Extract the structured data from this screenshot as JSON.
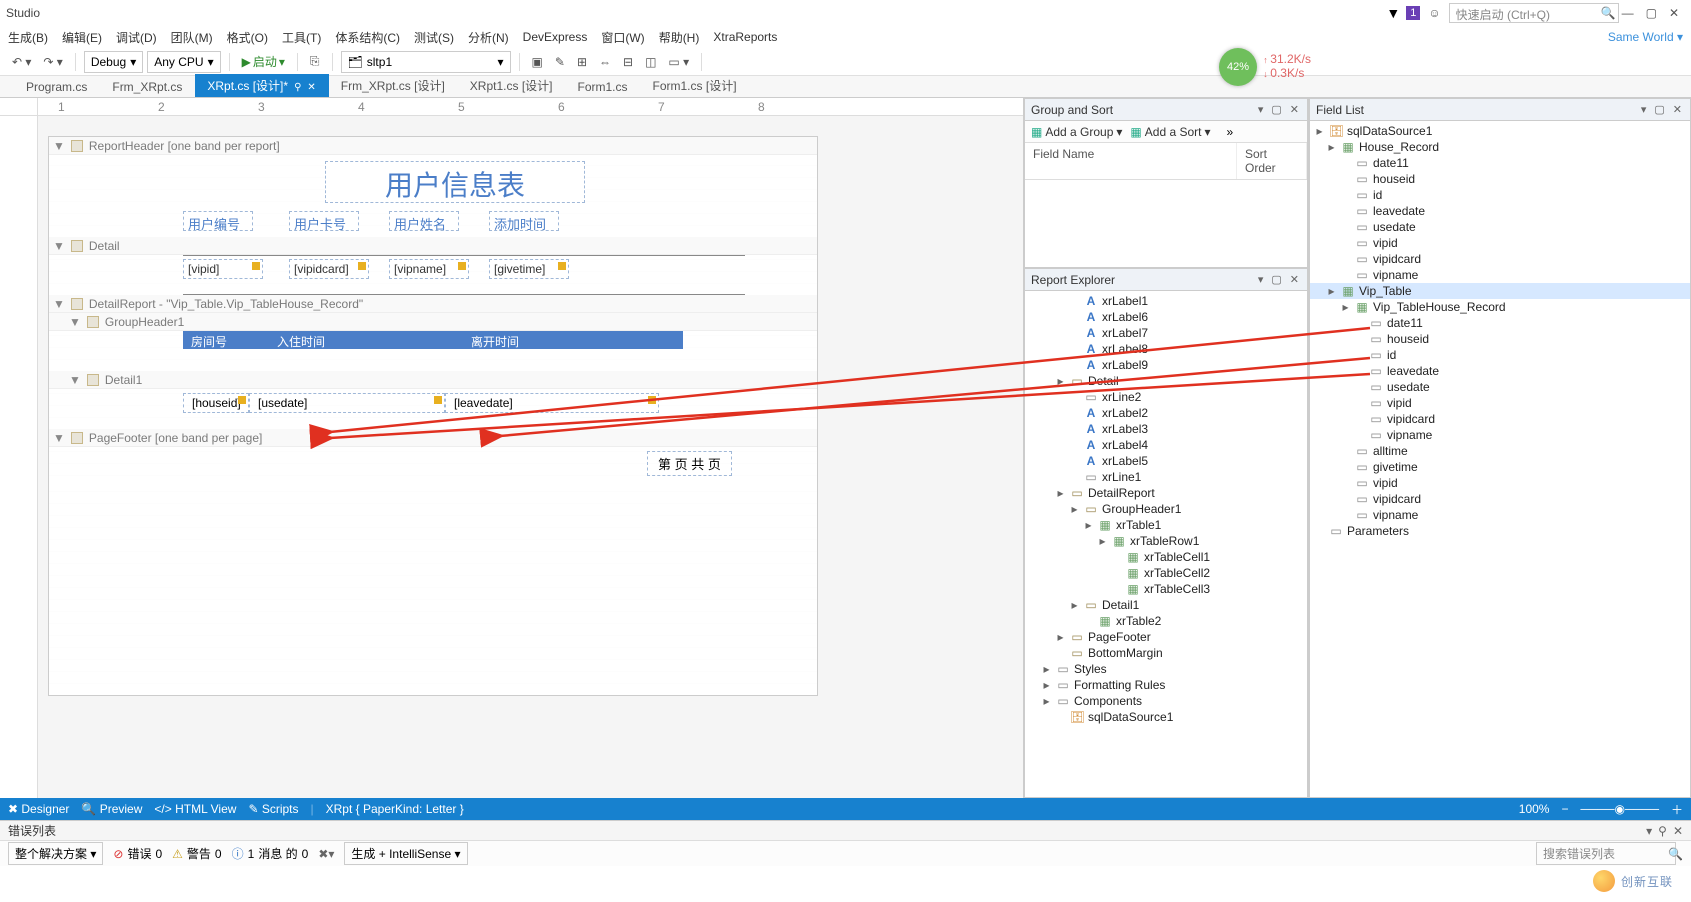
{
  "title_bar": {
    "title": "Studio",
    "quick_launch_placeholder": "快速启动 (Ctrl+Q)",
    "badge": "1"
  },
  "menu": {
    "items": [
      "生成(B)",
      "编辑(E)",
      "调试(D)",
      "团队(M)",
      "格式(O)",
      "工具(T)",
      "体系结构(C)",
      "测试(S)",
      "分析(N)",
      "DevExpress",
      "窗口(W)",
      "帮助(H)",
      "XtraReports"
    ],
    "right_label": "Same World"
  },
  "toolbar": {
    "debug": "Debug",
    "anycpu": "Any CPU",
    "start": "启动",
    "sltp": "sltp1"
  },
  "perf": {
    "pct": "42%",
    "up": "31.2K/s",
    "down": "0.3K/s"
  },
  "tabs": [
    {
      "label": "Program.cs"
    },
    {
      "label": "Frm_XRpt.cs"
    },
    {
      "label": "XRpt.cs [设计]*",
      "active": true
    },
    {
      "label": "Frm_XRpt.cs [设计]"
    },
    {
      "label": "XRpt1.cs [设计]"
    },
    {
      "label": "Form1.cs"
    },
    {
      "label": "Form1.cs [设计]"
    }
  ],
  "report": {
    "report_header_label": "ReportHeader [one band per report]",
    "title": "用户信息表",
    "col_labels": [
      "用户编号",
      "用户卡号",
      "用户姓名",
      "添加时间"
    ],
    "detail_label": "Detail",
    "fields": [
      "[vipid]",
      "[vipidcard]",
      "[vipname]",
      "[givetime]"
    ],
    "detail_report_label": "DetailReport - \"Vip_Table.Vip_TableHouse_Record\"",
    "group_header_label": "GroupHeader1",
    "gh_cols": [
      "房间号",
      "入住时间",
      "离开时间"
    ],
    "detail1_label": "Detail1",
    "d1_fields": [
      "[houseid]",
      "[usedate]",
      "[leavedate]"
    ],
    "page_footer_label": "PageFooter [one band per page]",
    "pf_text": "第 页 共 页"
  },
  "group_sort": {
    "title": "Group and Sort",
    "add_group": "Add a Group",
    "add_sort": "Add a Sort",
    "col_field": "Field Name",
    "col_order": "Sort Order"
  },
  "report_explorer": {
    "title": "Report Explorer",
    "nodes": [
      {
        "l": 3,
        "ic": "a",
        "t": "xrLabel1"
      },
      {
        "l": 3,
        "ic": "a",
        "t": "xrLabel6"
      },
      {
        "l": 3,
        "ic": "a",
        "t": "xrLabel7"
      },
      {
        "l": 3,
        "ic": "a",
        "t": "xrLabel8"
      },
      {
        "l": 3,
        "ic": "a",
        "t": "xrLabel9"
      },
      {
        "l": 2,
        "exp": "▸",
        "ic": "d",
        "t": "Detail"
      },
      {
        "l": 3,
        "ic": "l",
        "t": "xrLine2"
      },
      {
        "l": 3,
        "ic": "a",
        "t": "xrLabel2"
      },
      {
        "l": 3,
        "ic": "a",
        "t": "xrLabel3"
      },
      {
        "l": 3,
        "ic": "a",
        "t": "xrLabel4"
      },
      {
        "l": 3,
        "ic": "a",
        "t": "xrLabel5"
      },
      {
        "l": 3,
        "ic": "l",
        "t": "xrLine1"
      },
      {
        "l": 2,
        "exp": "▸",
        "ic": "d",
        "t": "DetailReport"
      },
      {
        "l": 3,
        "exp": "▸",
        "ic": "d",
        "t": "GroupHeader1"
      },
      {
        "l": 4,
        "exp": "▸",
        "ic": "t",
        "t": "xrTable1"
      },
      {
        "l": 5,
        "exp": "▸",
        "ic": "t",
        "t": "xrTableRow1"
      },
      {
        "l": 6,
        "ic": "t",
        "t": "xrTableCell1"
      },
      {
        "l": 6,
        "ic": "t",
        "t": "xrTableCell2"
      },
      {
        "l": 6,
        "ic": "t",
        "t": "xrTableCell3"
      },
      {
        "l": 3,
        "exp": "▸",
        "ic": "d",
        "t": "Detail1"
      },
      {
        "l": 4,
        "ic": "t",
        "t": "xrTable2"
      },
      {
        "l": 2,
        "exp": "▸",
        "ic": "d",
        "t": "PageFooter"
      },
      {
        "l": 2,
        "ic": "d",
        "t": "BottomMargin"
      },
      {
        "l": 1,
        "exp": "▸",
        "ic": "l",
        "t": "Styles"
      },
      {
        "l": 1,
        "exp": "▸",
        "ic": "l",
        "t": "Formatting Rules"
      },
      {
        "l": 1,
        "exp": "▸",
        "ic": "l",
        "t": "Components"
      },
      {
        "l": 2,
        "ic": "db",
        "t": "sqlDataSource1"
      }
    ]
  },
  "field_list": {
    "title": "Field List",
    "nodes": [
      {
        "l": 0,
        "exp": "▸",
        "ic": "db",
        "t": "sqlDataSource1"
      },
      {
        "l": 1,
        "exp": "▸",
        "ic": "t",
        "t": "House_Record"
      },
      {
        "l": 2,
        "ic": "l",
        "t": "date11"
      },
      {
        "l": 2,
        "ic": "l",
        "t": "houseid"
      },
      {
        "l": 2,
        "ic": "l",
        "t": "id"
      },
      {
        "l": 2,
        "ic": "l",
        "t": "leavedate"
      },
      {
        "l": 2,
        "ic": "l",
        "t": "usedate"
      },
      {
        "l": 2,
        "ic": "l",
        "t": "vipid"
      },
      {
        "l": 2,
        "ic": "l",
        "t": "vipidcard"
      },
      {
        "l": 2,
        "ic": "l",
        "t": "vipname"
      },
      {
        "l": 1,
        "exp": "▸",
        "ic": "t",
        "t": "Vip_Table",
        "sel": true
      },
      {
        "l": 2,
        "exp": "▸",
        "ic": "t",
        "t": "Vip_TableHouse_Record"
      },
      {
        "l": 3,
        "ic": "l",
        "t": "date11"
      },
      {
        "l": 3,
        "ic": "l",
        "t": "houseid"
      },
      {
        "l": 3,
        "ic": "l",
        "t": "id"
      },
      {
        "l": 3,
        "ic": "l",
        "t": "leavedate"
      },
      {
        "l": 3,
        "ic": "l",
        "t": "usedate"
      },
      {
        "l": 3,
        "ic": "l",
        "t": "vipid"
      },
      {
        "l": 3,
        "ic": "l",
        "t": "vipidcard"
      },
      {
        "l": 3,
        "ic": "l",
        "t": "vipname"
      },
      {
        "l": 2,
        "ic": "l",
        "t": "alltime"
      },
      {
        "l": 2,
        "ic": "l",
        "t": "givetime"
      },
      {
        "l": 2,
        "ic": "l",
        "t": "vipid"
      },
      {
        "l": 2,
        "ic": "l",
        "t": "vipidcard"
      },
      {
        "l": 2,
        "ic": "l",
        "t": "vipname"
      },
      {
        "l": 0,
        "ic": "l",
        "t": "Parameters"
      }
    ]
  },
  "bottom_tabs": {
    "designer": "Designer",
    "preview": "Preview",
    "html": "HTML View",
    "scripts": "Scripts",
    "paper": "XRpt { PaperKind: Letter }",
    "zoom": "100%"
  },
  "error_list": {
    "title": "错误列表"
  },
  "status": {
    "solution": "整个解决方案",
    "errors_label": "错误",
    "errors_n": "0",
    "warn_label": "警告",
    "warn_n": "0",
    "msg_label": "消息 的",
    "msg_n": "1",
    "msg_of": "0",
    "intelli": "生成 + IntelliSense",
    "search": "搜索错误列表"
  },
  "watermark": "创新互联"
}
